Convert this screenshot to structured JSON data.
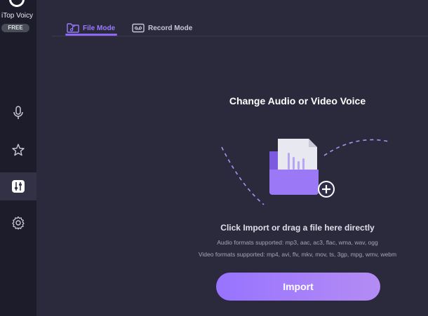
{
  "app": {
    "name": "iTop Voicy",
    "badge": "FREE"
  },
  "sidebar": {
    "items": [
      {
        "icon": "microphone-icon",
        "active": false
      },
      {
        "icon": "sparkle-star-icon",
        "active": false
      },
      {
        "icon": "mixer-icon",
        "active": true
      },
      {
        "icon": "gear-icon",
        "active": false
      }
    ]
  },
  "tabs": [
    {
      "label": "File Mode",
      "icon": "folder-music-icon",
      "active": true
    },
    {
      "label": "Record Mode",
      "icon": "cassette-tape-icon",
      "active": false
    }
  ],
  "main": {
    "heading": "Change Audio or Video Voice",
    "subheading": "Click Import or drag a file here directly",
    "audio_formats": "Audio formats supported: mp3, aac, ac3, flac, wma, wav, ogg",
    "video_formats": "Video formats supported: mp4, avi, flv, mkv, mov, ts, 3gp, mpg, wmv, webm",
    "import_label": "Import"
  },
  "colors": {
    "accent": "#8d67f5",
    "background": "#2b2a3d",
    "sidebar": "#1d1c2b"
  }
}
